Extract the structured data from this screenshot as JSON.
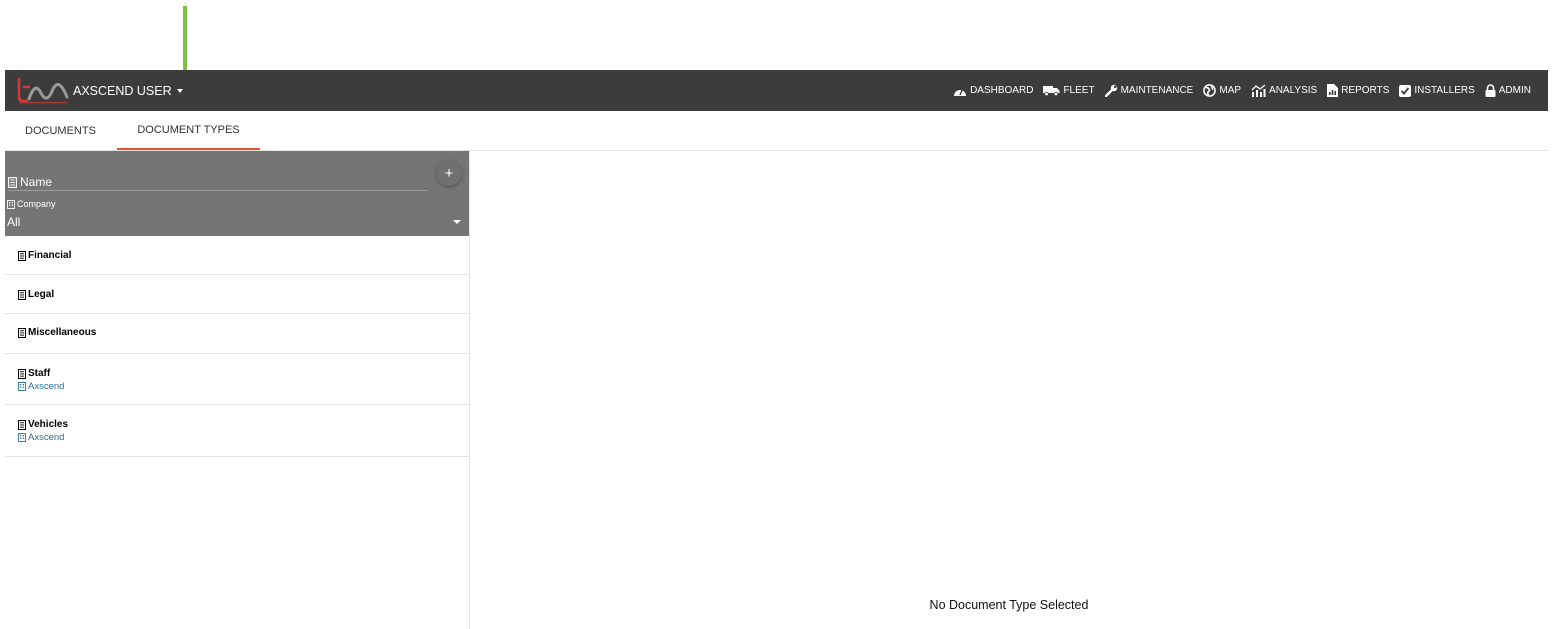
{
  "header": {
    "user_label": "AXSCEND USER",
    "nav": [
      {
        "icon": "dashboard-icon",
        "label": "DASHBOARD"
      },
      {
        "icon": "truck-icon",
        "label": "FLEET"
      },
      {
        "icon": "wrench-icon",
        "label": "MAINTENANCE"
      },
      {
        "icon": "globe-icon",
        "label": "MAP"
      },
      {
        "icon": "analysis-icon",
        "label": "ANALYSIS"
      },
      {
        "icon": "report-icon",
        "label": "REPORTS"
      },
      {
        "icon": "checkbox-icon",
        "label": "INSTALLERS"
      },
      {
        "icon": "lock-icon",
        "label": "ADMIN"
      }
    ]
  },
  "tabs": {
    "documents": "DOCUMENTS",
    "document_types": "DOCUMENT TYPES"
  },
  "filters": {
    "name_placeholder": "Name",
    "add_label": "+",
    "company_label": "Company",
    "company_value": "All"
  },
  "list": [
    {
      "title": "Financial",
      "company": ""
    },
    {
      "title": "Legal",
      "company": ""
    },
    {
      "title": "Miscellaneous",
      "company": ""
    },
    {
      "title": "Staff",
      "company": "Axscend"
    },
    {
      "title": "Vehicles",
      "company": "Axscend"
    }
  ],
  "detail": {
    "empty_message": "No Document Type Selected"
  },
  "colors": {
    "topbar": "#3c3c3c",
    "tab_active_underline": "#e8532b",
    "filter_panel": "#757575",
    "annotation_arrow": "#7dc242",
    "company_link": "#2a6f97"
  }
}
